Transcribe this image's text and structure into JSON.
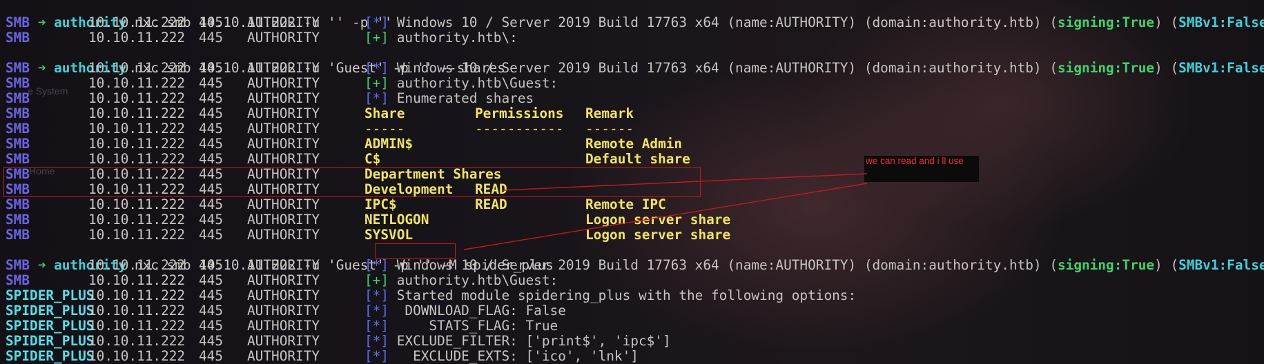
{
  "prompt": {
    "arrow": "➜",
    "dir": "authority"
  },
  "commands": [
    "nxc smb 10.10.11.222 -u '' -p ''",
    "nxc smb 10.10.11.222 -u 'Guest' -p '' --shares",
    "nxc smb 10.10.11.222 -u 'Guest' -p '' -M ",
    "spider_plus"
  ],
  "common": {
    "smb": "SMB",
    "spider": "SPIDER_PLUS",
    "ip": "10.10.11.222",
    "port": "445",
    "host": "AUTHORITY",
    "star": "[*]",
    "plus": "[+]"
  },
  "info": {
    "os": "Windows 10 / Server 2019 Build 17763 x64 (name:AUTHORITY) (domain:authority.htb) (",
    "signing": "signing:True",
    "mid": ") (",
    "smbv1": "SMBv1:False",
    "end": ")"
  },
  "messages": {
    "auth_anon": "authority.htb\\:",
    "auth_guest": "authority.htb\\Guest:",
    "enum": "Enumerated shares",
    "spider_started": "Started module spidering_plus with the following options:",
    "download_flag": " DOWNLOAD_FLAG: False",
    "stats_flag": "    STATS_FLAG: True",
    "exclude_filter": "EXCLUDE_FILTER: ['print$', 'ipc$']",
    "exclude_exts": "  EXCLUDE_EXTS: ['ico', 'lnk']"
  },
  "share_headers": {
    "share": "Share",
    "perm": "Permissions",
    "remark": "Remark"
  },
  "share_rules": {
    "share": "-----",
    "perm": "-----------",
    "remark": "------"
  },
  "shares": [
    {
      "name": "ADMIN$",
      "perm": "",
      "remark": "Remote Admin"
    },
    {
      "name": "C$",
      "perm": "",
      "remark": "Default share"
    },
    {
      "name": "Department Shares",
      "perm": "",
      "remark": ""
    },
    {
      "name": "Development",
      "perm": "READ",
      "remark": ""
    },
    {
      "name": "IPC$",
      "perm": "READ",
      "remark": "Remote IPC"
    },
    {
      "name": "NETLOGON",
      "perm": "",
      "remark": "Logon server share"
    },
    {
      "name": "SYSVOL",
      "perm": "",
      "remark": "Logon server share"
    }
  ],
  "annotation": {
    "text": "we can read and i ll use"
  },
  "ghost": {
    "file_system": "e System",
    "home": "Home"
  },
  "colors": {
    "annotation": "#ff2a2a",
    "box": "#c81818"
  }
}
